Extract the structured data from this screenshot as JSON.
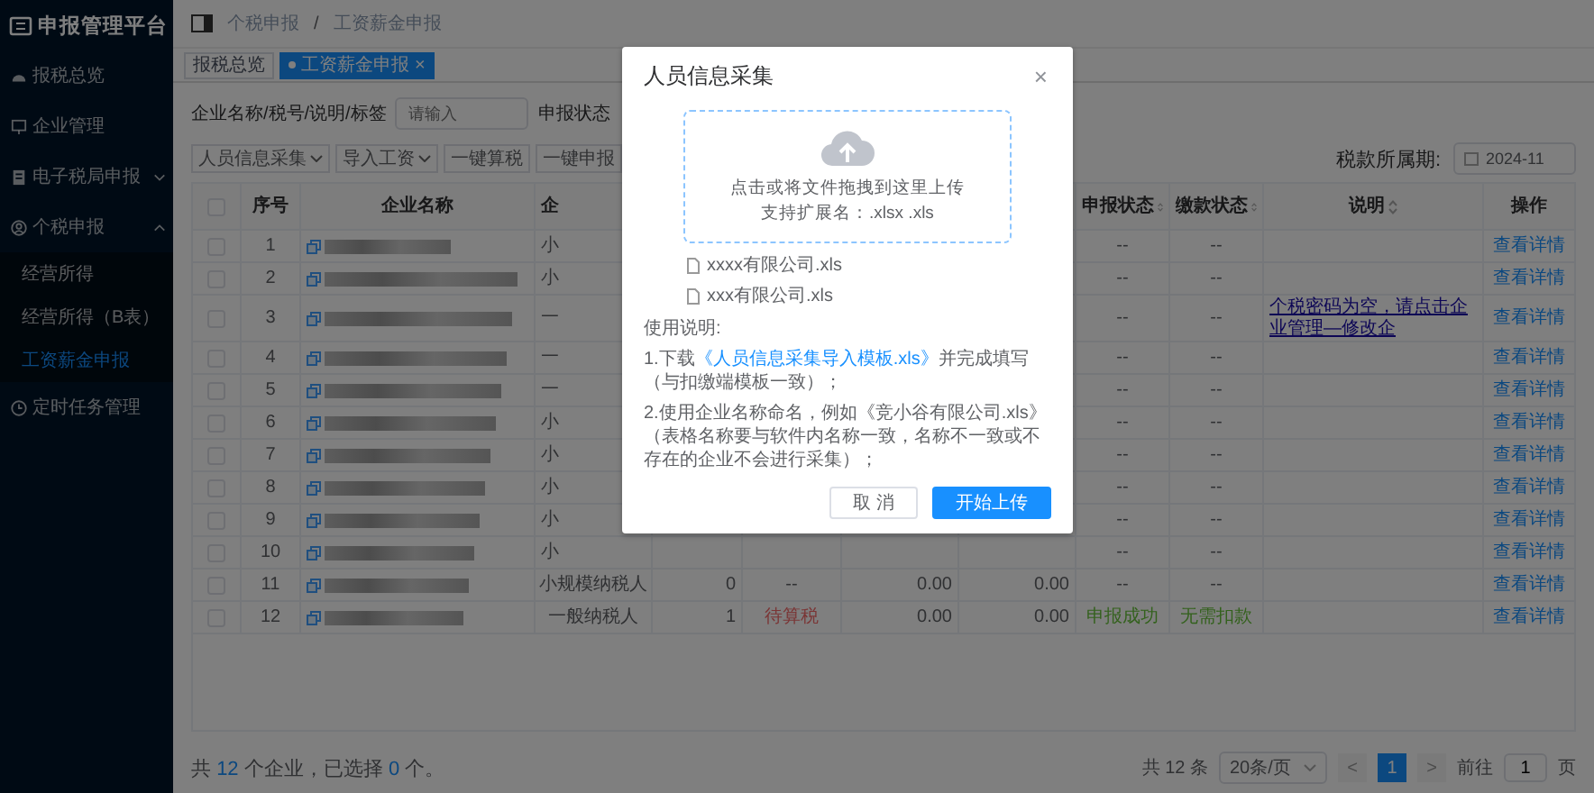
{
  "sidebar": {
    "title": "申报管理平台",
    "items": [
      {
        "label": "报税总览",
        "selected": false
      },
      {
        "label": "企业管理",
        "selected": false
      },
      {
        "label": "电子税局申报",
        "selected": false,
        "expanded": false
      },
      {
        "label": "个税申报",
        "selected": false,
        "expanded": true,
        "children": [
          {
            "label": "经营所得",
            "selected": false
          },
          {
            "label": "经营所得（B表）",
            "selected": false
          },
          {
            "label": "工资薪金申报",
            "selected": true
          }
        ]
      },
      {
        "label": "定时任务管理",
        "selected": false
      }
    ]
  },
  "breadcrumb": [
    "个税申报",
    "/",
    "工资薪金申报"
  ],
  "tabs": [
    {
      "label": "报税总览",
      "selected": false
    },
    {
      "label": "工资薪金申报",
      "selected": true,
      "close": "×"
    }
  ],
  "filters": {
    "name_label": "企业名称/税号/说明/标签",
    "name_placeholder": "请输入",
    "status_label": "申报状态"
  },
  "toolbar": {
    "buttons": [
      {
        "label": "人员信息采集",
        "dropdown": true
      },
      {
        "label": "导入工资",
        "dropdown": true
      },
      {
        "label": "一键算税",
        "dropdown": false
      },
      {
        "label": "一键申报",
        "dropdown": false
      }
    ],
    "period_label": "税款所属期:",
    "period_value": "2024-11"
  },
  "table": {
    "header": {
      "checked": false,
      "index": "序号",
      "name": "企业名称",
      "column_4": "企",
      "declare_status": "申报状态",
      "payment_status": "缴款状态",
      "note": "说明",
      "action": "操作"
    },
    "rows": [
      {
        "checked": false,
        "index": "1",
        "column_4": "小",
        "declare_status": {
          "text": "--",
          "kind": "none"
        },
        "payment_status": {
          "text": "--",
          "kind": "none"
        },
        "action": "查看详情"
      },
      {
        "checked": false,
        "index": "2",
        "column_4": "小",
        "declare_status": {
          "text": "--",
          "kind": "none"
        },
        "payment_status": {
          "text": "--",
          "kind": "none"
        },
        "action": "查看详情"
      },
      {
        "checked": false,
        "index": "3",
        "column_4": "一",
        "declare_status": {
          "text": "--",
          "kind": "none"
        },
        "payment_status": {
          "text": "--",
          "kind": "none"
        },
        "note": "个税密码为空，请点击企业管理—修改企",
        "action": "查看详情"
      },
      {
        "checked": false,
        "index": "4",
        "column_4": "一",
        "declare_status": {
          "text": "--",
          "kind": "none"
        },
        "payment_status": {
          "text": "--",
          "kind": "none"
        },
        "action": "查看详情"
      },
      {
        "checked": false,
        "index": "5",
        "column_4": "一",
        "declare_status": {
          "text": "--",
          "kind": "none"
        },
        "payment_status": {
          "text": "--",
          "kind": "none"
        },
        "action": "查看详情"
      },
      {
        "checked": false,
        "index": "6",
        "column_4": "小",
        "declare_status": {
          "text": "--",
          "kind": "none"
        },
        "payment_status": {
          "text": "--",
          "kind": "none"
        },
        "action": "查看详情"
      },
      {
        "checked": false,
        "index": "7",
        "column_4": "小",
        "declare_status": {
          "text": "--",
          "kind": "none"
        },
        "payment_status": {
          "text": "--",
          "kind": "none"
        },
        "action": "查看详情"
      },
      {
        "checked": false,
        "index": "8",
        "column_4": "小",
        "declare_status": {
          "text": "--",
          "kind": "none"
        },
        "payment_status": {
          "text": "--",
          "kind": "none"
        },
        "action": "查看详情"
      },
      {
        "checked": false,
        "index": "9",
        "column_4": "小",
        "declare_status": {
          "text": "--",
          "kind": "none"
        },
        "payment_status": {
          "text": "--",
          "kind": "none"
        },
        "action": "查看详情"
      },
      {
        "checked": false,
        "index": "10",
        "column_4": "小",
        "declare_status": {
          "text": "--",
          "kind": "none"
        },
        "payment_status": {
          "text": "--",
          "kind": "none"
        },
        "action": "查看详情"
      },
      {
        "checked": false,
        "index": "11",
        "column_4": "小规模纳税人",
        "column_5": "0",
        "column_6": {
          "text": "--",
          "kind": "none"
        },
        "column_7": "0.00",
        "column_8": "0.00",
        "declare_status": {
          "text": "--",
          "kind": "none"
        },
        "payment_status": {
          "text": "--",
          "kind": "none"
        },
        "action": "查看详情"
      },
      {
        "checked": false,
        "index": "12",
        "column_4": "一般纳税人",
        "column_5": "1",
        "column_6": {
          "text": "待算税",
          "kind": "warning"
        },
        "column_7": "0.00",
        "column_8": "0.00",
        "declare_status": {
          "text": "申报成功",
          "kind": "success"
        },
        "payment_status": {
          "text": "无需扣款",
          "kind": "success"
        },
        "action": "查看详情"
      }
    ]
  },
  "summary": [
    {
      "text": "共 ",
      "highlight": false
    },
    {
      "text": "12",
      "highlight": true
    },
    {
      "text": " 个企业，已选择 ",
      "highlight": false
    },
    {
      "text": "0",
      "highlight": true
    },
    {
      "text": " 个。",
      "highlight": false
    }
  ],
  "pagination": {
    "total": "共 12 条",
    "page_size": "20条/页",
    "prev": "<",
    "pages": [
      {
        "label": "1",
        "selected": true
      }
    ],
    "next": ">",
    "goto_label": "前往",
    "goto_value": "1",
    "goto_suffix": "页"
  },
  "dialog": {
    "title": "人员信息采集",
    "close": "×",
    "upload_text": "点击或将文件拖拽到这里上传",
    "upload_hint": "支持扩展名：.xlsx .xls",
    "files": [
      "xxxx有限公司.xls",
      "xxx有限公司.xls"
    ],
    "instructions_title": "使用说明:",
    "instructions": [
      {
        "before": "1.下载",
        "link": "《人员信息采集导入模板.xls》",
        "after": "并完成填写（与扣缴端模板一致）；"
      },
      {
        "before": "2.使用企业名称命名，例如《竞小谷有限公司.xls》（表格名称要与软件内名称一致，名称不一致或不存在的企业不会进行采集）；"
      }
    ],
    "buttons": [
      {
        "label": "取 消",
        "primary": false
      },
      {
        "label": "开始上传",
        "primary": true
      }
    ]
  }
}
